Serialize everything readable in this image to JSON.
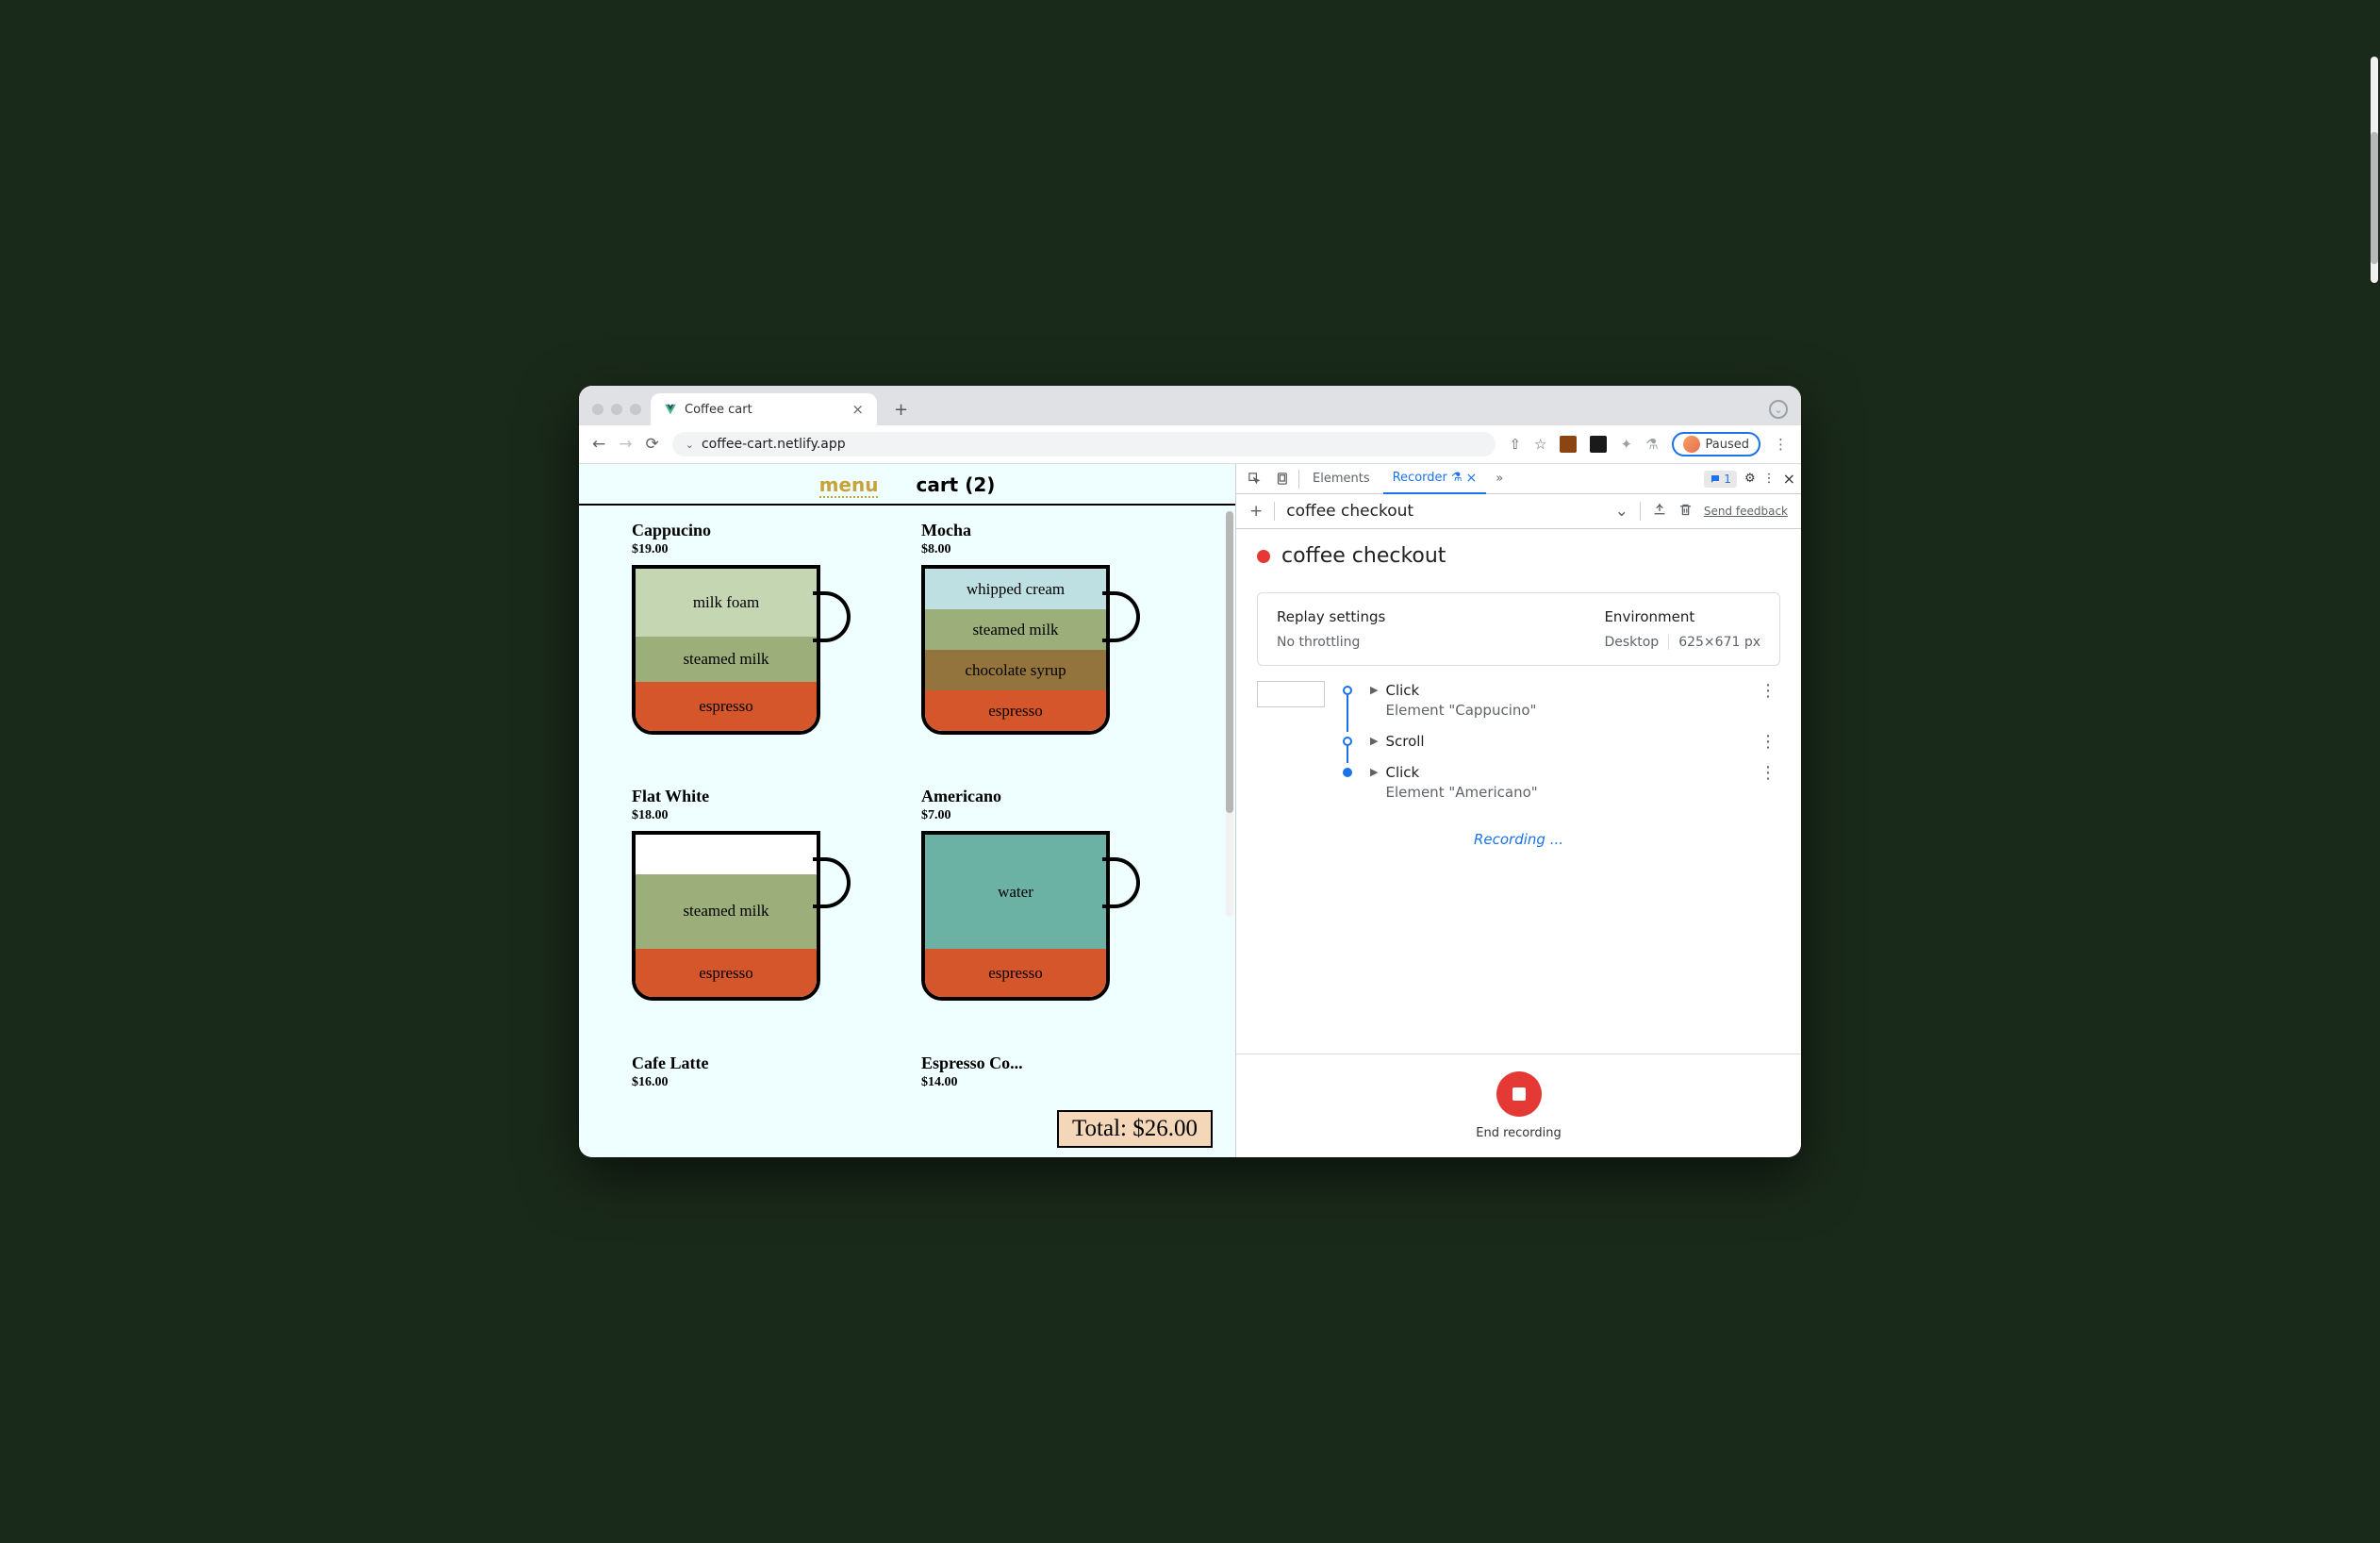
{
  "browser": {
    "tab_title": "Coffee cart",
    "url": "coffee-cart.netlify.app",
    "paused_label": "Paused"
  },
  "page": {
    "nav": {
      "menu": "menu",
      "cart": "cart (2)"
    },
    "products": [
      {
        "name": "Cappucino",
        "price": "$19.00",
        "layers": [
          {
            "label": "milk foam",
            "color": "#c5d6b2",
            "h": 42
          },
          {
            "label": "steamed milk",
            "color": "#9caf7a",
            "h": 28
          },
          {
            "label": "espresso",
            "color": "#d5562a",
            "h": 30
          }
        ]
      },
      {
        "name": "Mocha",
        "price": "$8.00",
        "layers": [
          {
            "label": "whipped cream",
            "color": "#bfe0e2",
            "h": 25
          },
          {
            "label": "steamed milk",
            "color": "#9caf7a",
            "h": 25
          },
          {
            "label": "chocolate syrup",
            "color": "#94743d",
            "h": 25
          },
          {
            "label": "espresso",
            "color": "#d5562a",
            "h": 25
          }
        ]
      },
      {
        "name": "Flat White",
        "price": "$18.00",
        "layers": [
          {
            "label": "",
            "color": "#ffffff",
            "h": 24
          },
          {
            "label": "steamed milk",
            "color": "#9caf7a",
            "h": 46
          },
          {
            "label": "espresso",
            "color": "#d5562a",
            "h": 30
          }
        ]
      },
      {
        "name": "Americano",
        "price": "$7.00",
        "layers": [
          {
            "label": "water",
            "color": "#6bb2a5",
            "h": 70
          },
          {
            "label": "espresso",
            "color": "#d5562a",
            "h": 30
          }
        ]
      },
      {
        "name": "Cafe Latte",
        "price": "$16.00",
        "layers": []
      },
      {
        "name": "Espresso Co...",
        "price": "$14.00",
        "layers": []
      }
    ],
    "total": "Total: $26.00"
  },
  "devtools": {
    "tabs": {
      "elements": "Elements",
      "recorder": "Recorder"
    },
    "msg_count": "1",
    "recording_name": "coffee checkout",
    "send_feedback": "Send feedback",
    "title": "coffee checkout",
    "replay": {
      "heading": "Replay settings",
      "value": "No throttling"
    },
    "env": {
      "heading": "Environment",
      "device": "Desktop",
      "size": "625×671 px"
    },
    "steps": [
      {
        "action": "Click",
        "detail": "Element \"Cappucino\"",
        "partial": true
      },
      {
        "action": "Scroll",
        "detail": ""
      },
      {
        "action": "Click",
        "detail": "Element \"Americano\""
      }
    ],
    "recording_label": "Recording ...",
    "end_label": "End recording"
  }
}
